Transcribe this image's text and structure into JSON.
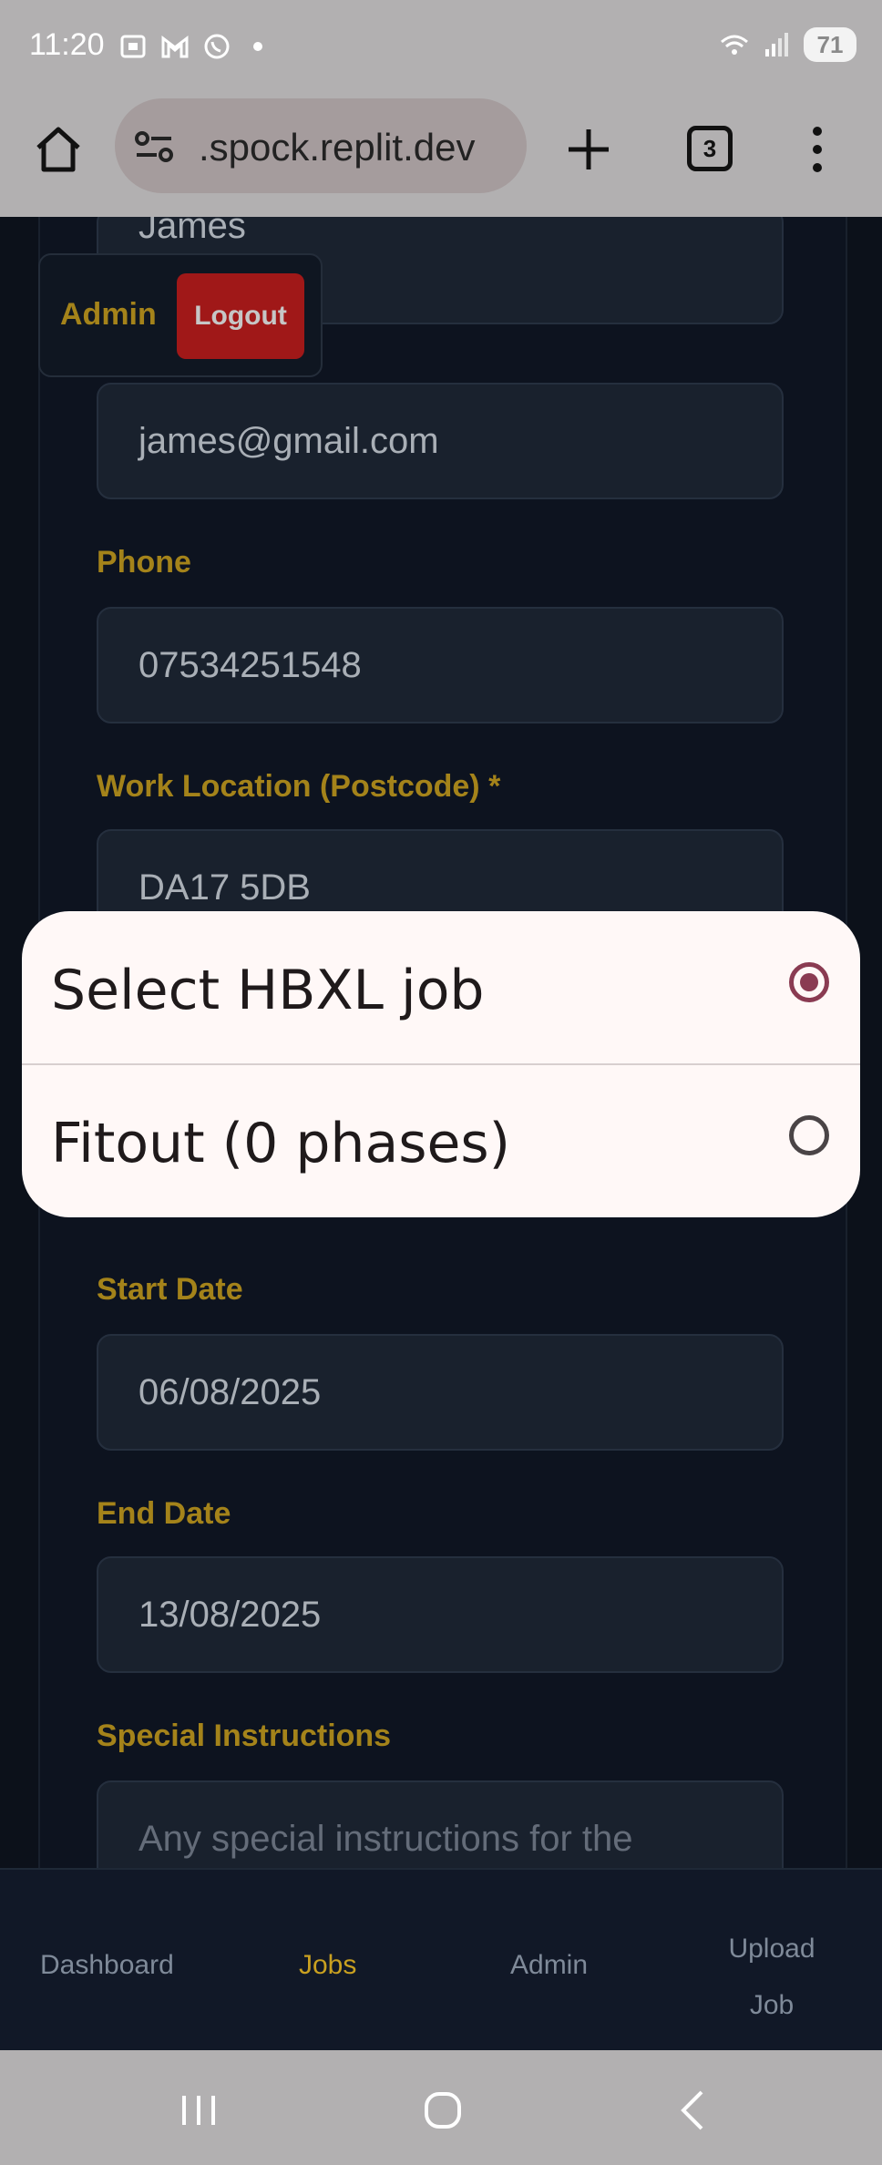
{
  "status_bar": {
    "time": "11:20",
    "battery": "71",
    "icons": [
      "screenshot-icon",
      "gmail-icon",
      "whatsapp-icon",
      "notification-dot",
      "wifi-icon",
      "signal-icon"
    ]
  },
  "browser": {
    "url": ".spock.replit.dev",
    "tab_count": "3"
  },
  "header": {
    "admin_label": "Admin",
    "logout_label": "Logout"
  },
  "form": {
    "name_value": "James",
    "email_value": "james@gmail.com",
    "phone_label": "Phone",
    "phone_value": "07534251548",
    "location_label": "Work Location (Postcode) *",
    "location_value": "DA17 5DB",
    "start_label": "Start Date",
    "start_value": "06/08/2025",
    "end_label": "End Date",
    "end_value": "13/08/2025",
    "instructions_label": "Special Instructions",
    "instructions_placeholder": "Any special instructions for the"
  },
  "bottom_nav": {
    "items": [
      {
        "label": "Dashboard"
      },
      {
        "label": "Jobs"
      },
      {
        "label": "Admin"
      },
      {
        "label": "Upload Job"
      }
    ],
    "active": "Jobs"
  },
  "dialog": {
    "options": [
      {
        "label": "Select HBXL job",
        "selected": true
      },
      {
        "label": "Fitout (0 phases)",
        "selected": false
      }
    ]
  },
  "colors": {
    "accent": "#c9a020",
    "danger": "#c41e1e",
    "radio_selected": "#8a3b52"
  }
}
